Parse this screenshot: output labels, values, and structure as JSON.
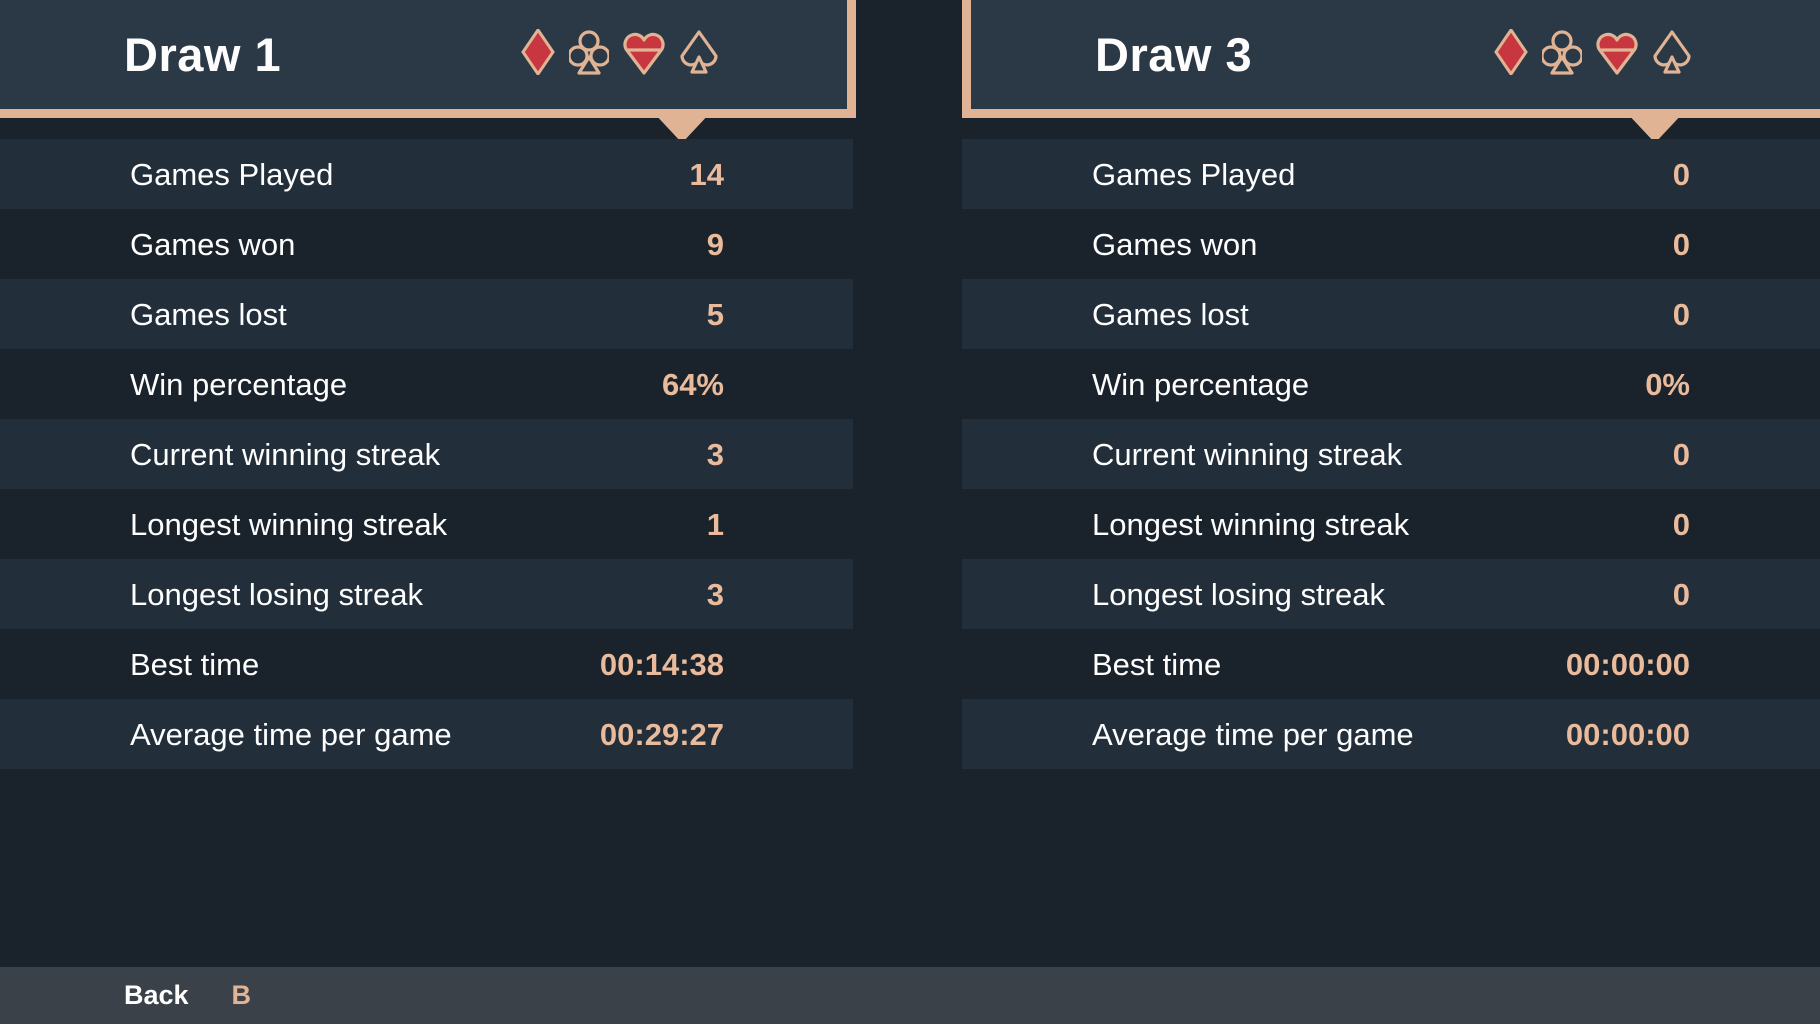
{
  "theme": {
    "background": "#1a222c",
    "panel_header_bg": "#2b3946",
    "accent_tan": "#e0b394",
    "value_color": "#e9bb9c",
    "label_color": "#fefefe",
    "row_stripe": "#222e3a",
    "footer_bg": "#3b4149",
    "suit_red": "#c8363f",
    "suit_dark": "#2b3946"
  },
  "panels": [
    {
      "id": "draw-1",
      "title": "Draw 1",
      "suit_icons": [
        "diamond-icon",
        "club-icon",
        "heart-icon",
        "spade-icon"
      ],
      "stats": [
        {
          "label": "Games Played",
          "value": "14"
        },
        {
          "label": "Games won",
          "value": "9"
        },
        {
          "label": "Games lost",
          "value": "5"
        },
        {
          "label": "Win percentage",
          "value": "64%"
        },
        {
          "label": "Current winning streak",
          "value": "3"
        },
        {
          "label": "Longest winning streak",
          "value": "1"
        },
        {
          "label": "Longest losing streak",
          "value": "3"
        },
        {
          "label": "Best time",
          "value": "00:14:38"
        },
        {
          "label": "Average time per game",
          "value": "00:29:27"
        }
      ]
    },
    {
      "id": "draw-3",
      "title": "Draw 3",
      "suit_icons": [
        "diamond-icon",
        "club-icon",
        "heart-icon",
        "spade-icon"
      ],
      "stats": [
        {
          "label": "Games Played",
          "value": "0"
        },
        {
          "label": "Games won",
          "value": "0"
        },
        {
          "label": "Games lost",
          "value": "0"
        },
        {
          "label": "Win percentage",
          "value": "0%"
        },
        {
          "label": "Current winning streak",
          "value": "0"
        },
        {
          "label": "Longest winning streak",
          "value": "0"
        },
        {
          "label": "Longest losing streak",
          "value": "0"
        },
        {
          "label": "Best time",
          "value": "00:00:00"
        },
        {
          "label": "Average time per game",
          "value": "00:00:00"
        }
      ]
    }
  ],
  "footer": {
    "back_label": "Back",
    "back_key": "B"
  }
}
